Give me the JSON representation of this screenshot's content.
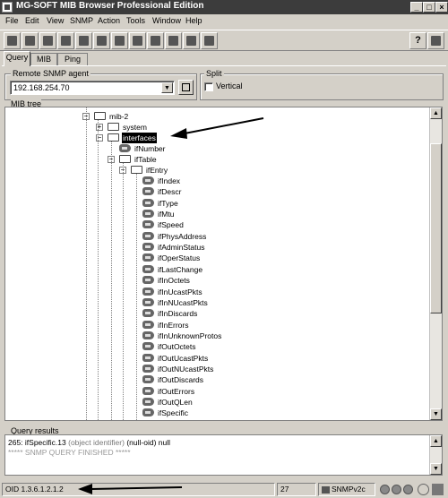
{
  "window": {
    "title": "MG-SOFT MIB Browser Professional Edition"
  },
  "menu": [
    "File",
    "Edit",
    "View",
    "SNMP",
    "Action",
    "Tools",
    "Window",
    "Help"
  ],
  "toolbar": {
    "help_label": "?"
  },
  "tabs": [
    "Query",
    "MIB",
    "Ping"
  ],
  "agent": {
    "label": "Remote SNMP agent",
    "value": "192.168.254.70"
  },
  "split": {
    "label": "Split",
    "vertical_label": "Vertical",
    "vertical_checked": false
  },
  "tree": {
    "label": "MIB tree",
    "nodes": [
      {
        "text": "mib-2",
        "kind": "folder",
        "expander": "-"
      },
      {
        "text": "system",
        "kind": "folder",
        "expander": "+"
      },
      {
        "text": "interfaces",
        "kind": "folder",
        "expander": "-",
        "selected": true
      },
      {
        "text": "ifNumber",
        "kind": "leaf"
      },
      {
        "text": "ifTable",
        "kind": "folder",
        "expander": "-"
      },
      {
        "text": "ifEntry",
        "kind": "folder",
        "expander": "-"
      },
      {
        "text": "ifIndex",
        "kind": "leaf"
      },
      {
        "text": "ifDescr",
        "kind": "leaf"
      },
      {
        "text": "ifType",
        "kind": "leaf"
      },
      {
        "text": "ifMtu",
        "kind": "leaf"
      },
      {
        "text": "ifSpeed",
        "kind": "leaf"
      },
      {
        "text": "ifPhysAddress",
        "kind": "leaf"
      },
      {
        "text": "ifAdminStatus",
        "kind": "leaf"
      },
      {
        "text": "ifOperStatus",
        "kind": "leaf"
      },
      {
        "text": "ifLastChange",
        "kind": "leaf"
      },
      {
        "text": "ifInOctets",
        "kind": "leaf"
      },
      {
        "text": "ifInUcastPkts",
        "kind": "leaf"
      },
      {
        "text": "ifInNUcastPkts",
        "kind": "leaf"
      },
      {
        "text": "ifInDiscards",
        "kind": "leaf"
      },
      {
        "text": "ifInErrors",
        "kind": "leaf"
      },
      {
        "text": "ifInUnknownProtos",
        "kind": "leaf"
      },
      {
        "text": "ifOutOctets",
        "kind": "leaf"
      },
      {
        "text": "ifOutUcastPkts",
        "kind": "leaf"
      },
      {
        "text": "ifOutNUcastPkts",
        "kind": "leaf"
      },
      {
        "text": "ifOutDiscards",
        "kind": "leaf"
      },
      {
        "text": "ifOutErrors",
        "kind": "leaf"
      },
      {
        "text": "ifOutQLen",
        "kind": "leaf"
      },
      {
        "text": "ifSpecific",
        "kind": "leaf"
      }
    ]
  },
  "results": {
    "label": "Query results",
    "line1_main": "265: ifSpecific.13",
    "line1_type": "(object identifier)",
    "line1_value": "(null-oid) null",
    "line2": "***** SNMP QUERY FINISHED *****"
  },
  "status": {
    "oid": "OID 1.3.6.1.2.1.2",
    "count": "27",
    "protocol": "SNMPv2c"
  }
}
